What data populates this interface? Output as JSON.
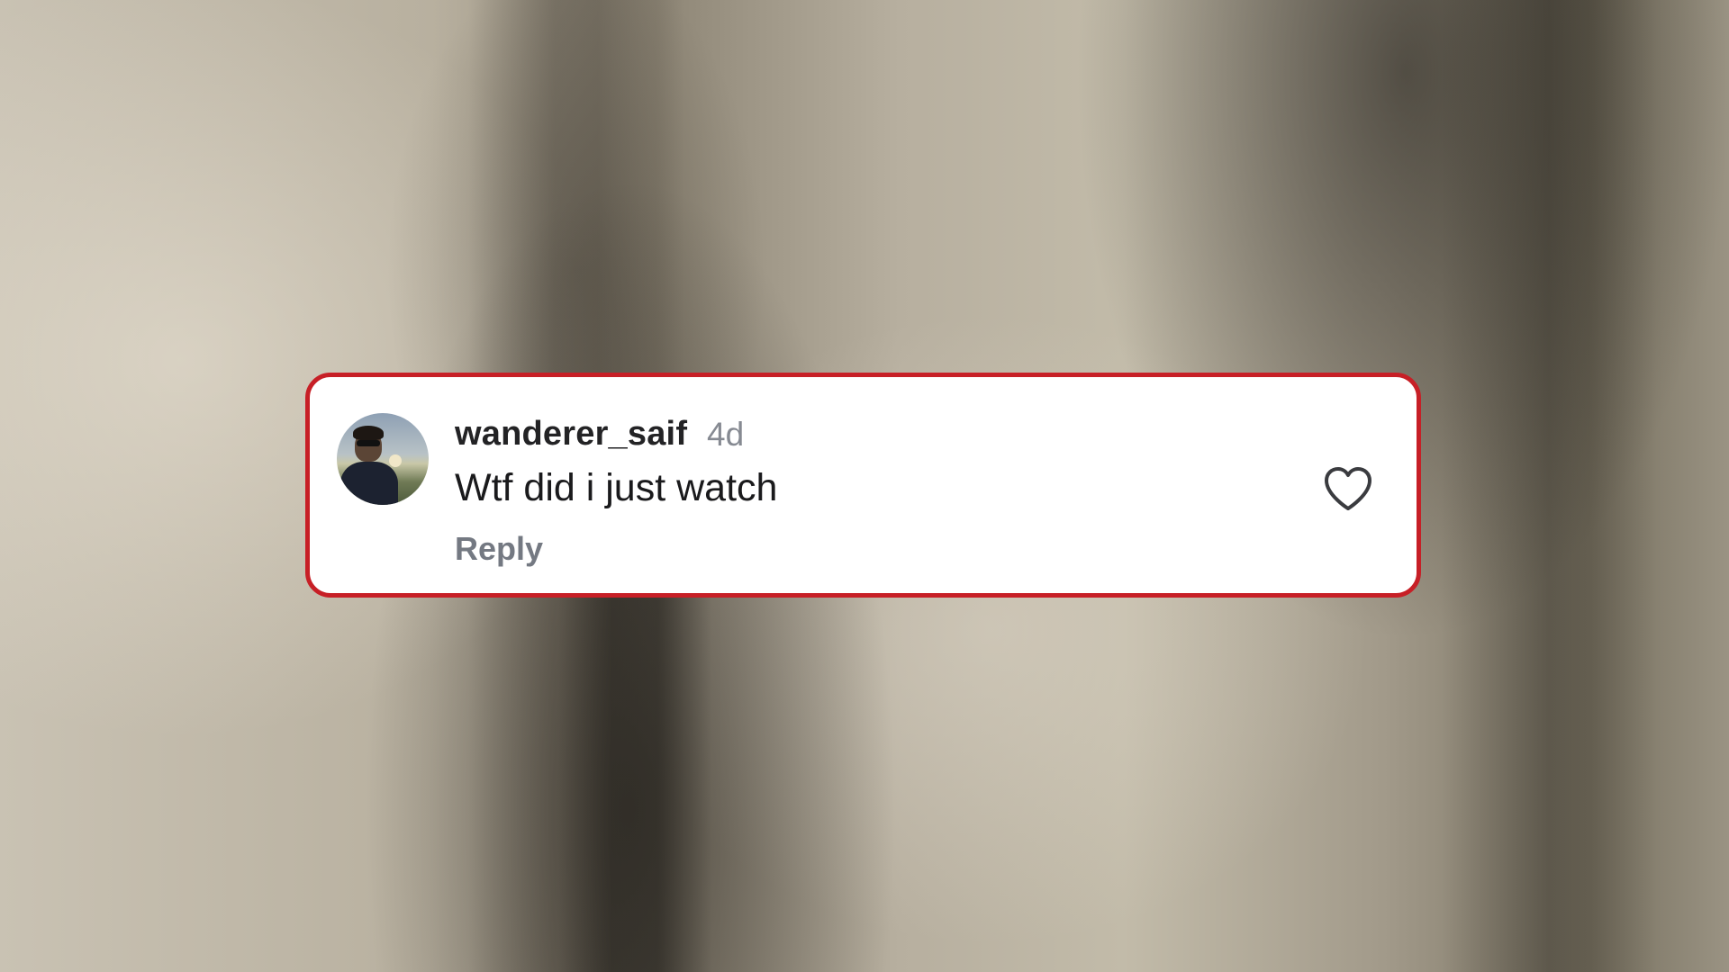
{
  "comment": {
    "username": "wanderer_saif",
    "time_ago": "4d",
    "text": "Wtf did i just watch",
    "reply_label": "Reply"
  },
  "icons": {
    "like": "heart-outline-icon",
    "avatar": "user-avatar"
  },
  "colors": {
    "card_border": "#c71f26",
    "card_background": "#ffffff",
    "username": "#232325",
    "muted": "#868a92",
    "reply": "#747982"
  }
}
